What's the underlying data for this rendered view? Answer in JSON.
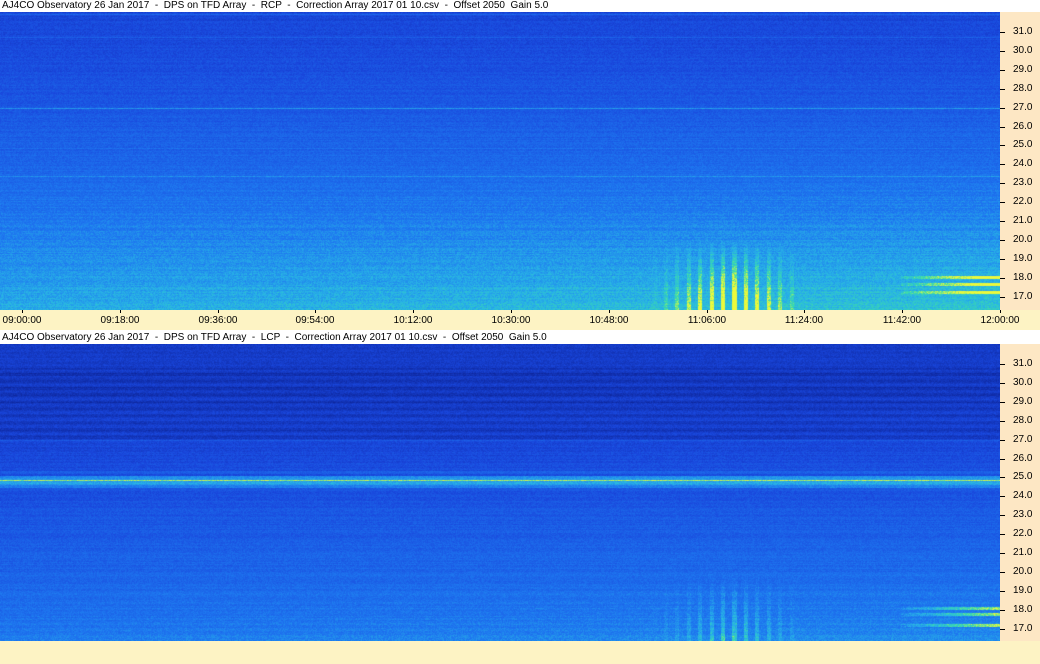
{
  "panels": [
    {
      "title": "AJ4CO Observatory 26 Jan 2017  -  DPS on TFD Array  -  RCP  -  Correction Array 2017 01 10.csv  -  Offset 2050  Gain 5.0",
      "polarization": "RCP"
    },
    {
      "title": "AJ4CO Observatory 26 Jan 2017  -  DPS on TFD Array  -  LCP  -  Correction Array 2017 01 10.csv  -  Offset 2050  Gain 5.0",
      "polarization": "LCP"
    }
  ],
  "y_axis": {
    "ticks": [
      "31.0",
      "30.0",
      "29.0",
      "28.0",
      "27.0",
      "26.0",
      "25.0",
      "24.0",
      "23.0",
      "22.0",
      "21.0",
      "20.0",
      "19.0",
      "18.0",
      "17.0"
    ]
  },
  "x_axis": {
    "ticks": [
      "09:00:00",
      "09:18:00",
      "09:36:00",
      "09:54:00",
      "10:12:00",
      "10:30:00",
      "10:48:00",
      "11:06:00",
      "11:24:00",
      "11:42:00",
      "12:00:00"
    ]
  },
  "colors": {
    "spectrogram_low": "#1a3fd6",
    "spectrogram_high": "#e8ff3a",
    "axis_background": "#fde7c4",
    "time_axis_background": "#fdf3c4"
  }
}
